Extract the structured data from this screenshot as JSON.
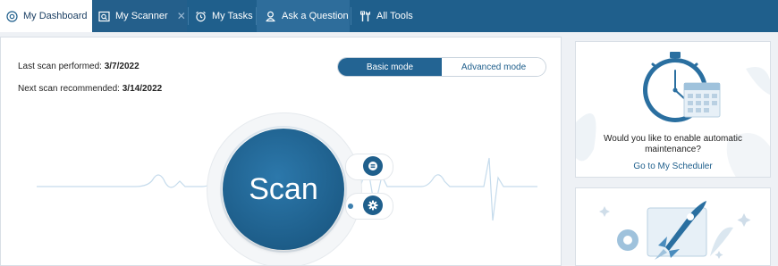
{
  "topbar": {
    "tabs": [
      {
        "label": "My Dashboard",
        "icon": "dashboard-icon",
        "active": true
      },
      {
        "label": "My Scanner",
        "icon": "scanner-icon",
        "closable": true
      },
      {
        "label": "My Tasks",
        "icon": "alarm-clock-icon"
      },
      {
        "label": "Ask a Question",
        "icon": "person-icon"
      },
      {
        "label": "All Tools",
        "icon": "tools-icon"
      }
    ],
    "close_glyph": "✕"
  },
  "scan_panel": {
    "last_scan_label": "Last scan performed:",
    "last_scan_date": "3/7/2022",
    "next_scan_label": "Next scan recommended:",
    "next_scan_date": "3/14/2022",
    "modes": {
      "basic": "Basic mode",
      "advanced": "Advanced mode",
      "selected": "basic"
    },
    "scan_button_label": "Scan",
    "side_buttons": [
      "list-icon",
      "gear-icon"
    ]
  },
  "cards": {
    "maintenance": {
      "question": "Would you like to enable automatic maintenance?",
      "link": "Go to My Scheduler",
      "illustration": "stopwatch-calendar-illustration"
    },
    "boost": {
      "illustration": "rocket-illustration"
    }
  },
  "colors": {
    "nav_bg": "#1f5f8c",
    "accent": "#236493",
    "link": "#1f5f8c"
  }
}
